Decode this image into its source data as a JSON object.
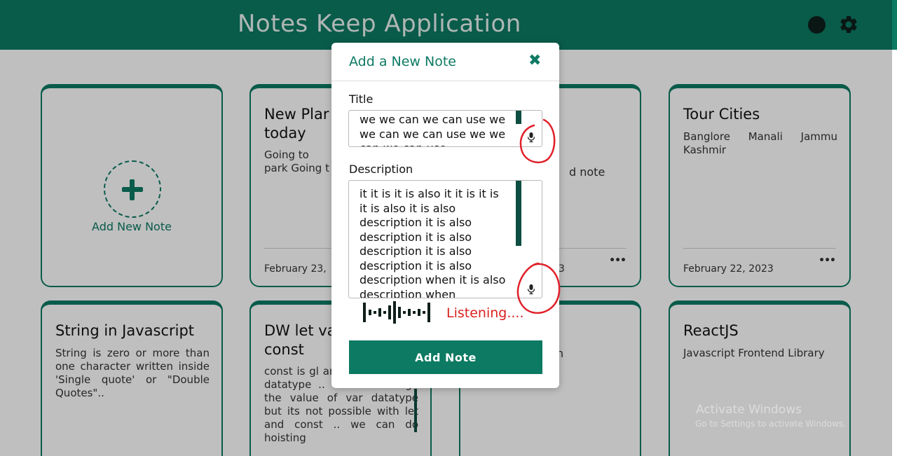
{
  "header": {
    "title": "Notes Keep Application"
  },
  "colors": {
    "primary": "#0d7a63",
    "listening": "#d9221f",
    "annotation": "#e0202a"
  },
  "add_note_card": {
    "label": "Add New Note"
  },
  "cards": [
    {
      "title": "New Plan today",
      "title_line1": "New Plar",
      "title_line2": "today",
      "desc_line1": "Going to",
      "desc_line2": "park Going t",
      "date": "February 23,",
      "menu": "•••"
    },
    {
      "title_visible": "d note",
      "date_visible": "3",
      "menu": "•••"
    },
    {
      "title": "Tour Cities",
      "desc": "Banglore Manali Jammu Kashmir",
      "date": "February 22, 2023",
      "menu": "•••"
    },
    {
      "title": "String in Javascript",
      "desc": "String is zero or more than one character written inside 'Single quote' or \"Double Quotes\".."
    },
    {
      "title_line1": "DW let va",
      "title_line2": "const",
      "desc": "const is gl and let & va level datatype .. we can change the value of var datatype but its not possible with let and const .. we can do hoisting"
    },
    {
      "title_visible": "n"
    },
    {
      "title": "ReactJS",
      "desc": "Javascript Frontend Library"
    }
  ],
  "modal": {
    "title": "Add a New Note",
    "close_icon": "close-icon",
    "title_label": "Title",
    "title_value": " we we can we can use we we can we can use we we can we can use",
    "description_label": "Description",
    "description_value": " it it is it is also it it is it is it is also it is also description it is also description it is also description it is also description it is also description when it is also description when",
    "listening_text": "Listening....",
    "add_button": "Add Note"
  },
  "watermark": {
    "line1": "Activate Windows",
    "line2": "Go to Settings to activate Windows."
  }
}
